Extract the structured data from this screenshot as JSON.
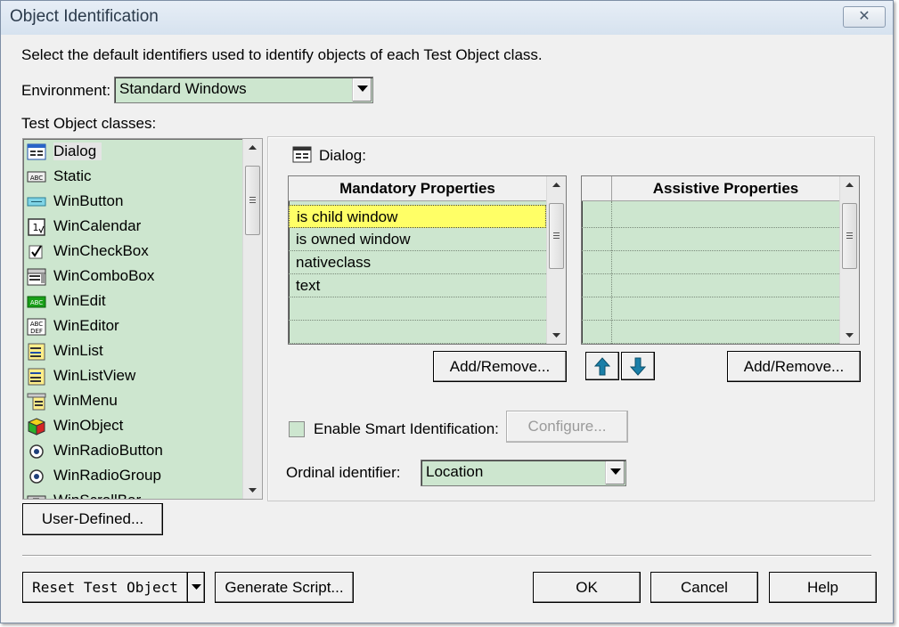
{
  "window": {
    "title": "Object Identification",
    "close_glyph": "✕"
  },
  "instructions": "Select the default identifiers used to identify objects of each Test Object class.",
  "environment": {
    "label": "Environment:",
    "value": "Standard Windows"
  },
  "classes": {
    "label": "Test Object classes:",
    "items": [
      {
        "label": "Dialog",
        "icon": "dialog-icon",
        "selected": true
      },
      {
        "label": "Static",
        "icon": "static-icon"
      },
      {
        "label": "WinButton",
        "icon": "button-icon"
      },
      {
        "label": "WinCalendar",
        "icon": "calendar-icon"
      },
      {
        "label": "WinCheckBox",
        "icon": "checkbox-icon"
      },
      {
        "label": "WinComboBox",
        "icon": "combobox-icon"
      },
      {
        "label": "WinEdit",
        "icon": "edit-icon"
      },
      {
        "label": "WinEditor",
        "icon": "editor-icon"
      },
      {
        "label": "WinList",
        "icon": "list-icon"
      },
      {
        "label": "WinListView",
        "icon": "listview-icon"
      },
      {
        "label": "WinMenu",
        "icon": "menu-icon"
      },
      {
        "label": "WinObject",
        "icon": "object-icon"
      },
      {
        "label": "WinRadioButton",
        "icon": "radio-icon"
      },
      {
        "label": "WinRadioGroup",
        "icon": "radio-icon"
      },
      {
        "label": "WinScrollBar",
        "icon": "scrollbar-icon"
      }
    ]
  },
  "selected_class": {
    "label": "Dialog:",
    "icon": "dialog-icon"
  },
  "mandatory": {
    "header": "Mandatory Properties",
    "rows": [
      "is child window",
      "is owned window",
      "nativeclass",
      "text",
      "",
      ""
    ],
    "add_remove_label": "Add/Remove..."
  },
  "assistive": {
    "header": "Assistive Properties",
    "rows": [
      "",
      "",
      "",
      "",
      "",
      ""
    ],
    "add_remove_label": "Add/Remove..."
  },
  "move": {
    "up_icon": "arrow-up-icon",
    "down_icon": "arrow-down-icon"
  },
  "smart_identification": {
    "label": "Enable Smart Identification:",
    "checked": false,
    "configure_label": "Configure..."
  },
  "ordinal": {
    "label": "Ordinal identifier:",
    "value": "Location"
  },
  "user_defined_label": "User-Defined...",
  "footer": {
    "reset_label": "Reset Test Object",
    "generate_label": "Generate Script...",
    "ok_label": "OK",
    "cancel_label": "Cancel",
    "help_label": "Help"
  },
  "colors": {
    "field_green": "#cde6cf",
    "highlight_yellow": "#ffff66",
    "dialog_gray": "#f0f0f0",
    "arrow_teal": "#1a7fa8"
  }
}
